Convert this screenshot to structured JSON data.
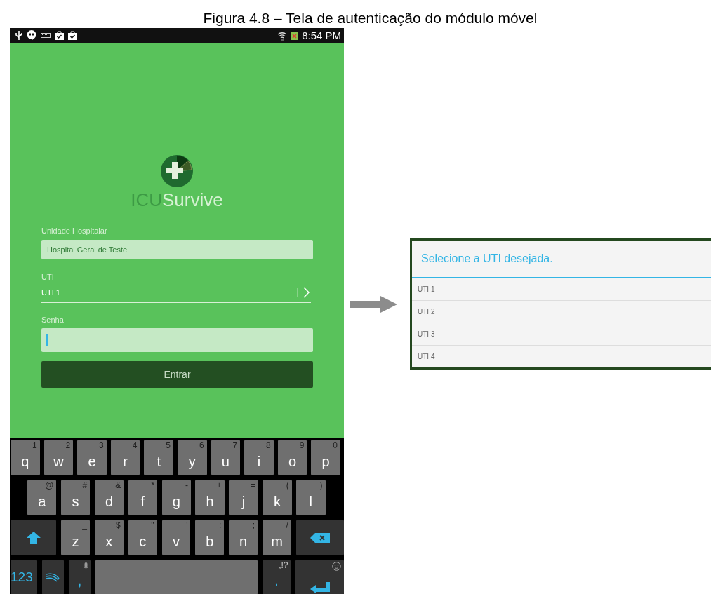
{
  "caption": "Figura 4.8 – Tela de autenticação do módulo móvel",
  "status_bar": {
    "time": "8:54 PM"
  },
  "app_name": {
    "prefix": "ICU",
    "suffix": "Survive"
  },
  "form": {
    "hospital": {
      "label": "Unidade Hospitalar",
      "value": "Hospital Geral de Teste"
    },
    "uti": {
      "label": "UTI",
      "value": "UTI 1"
    },
    "password": {
      "label": "Senha",
      "focused": true
    },
    "submit": "Entrar"
  },
  "keyboard": {
    "letter_row_1": [
      {
        "kind": "char",
        "label": "q",
        "hint": "1"
      },
      {
        "kind": "char",
        "label": "w",
        "hint": "2"
      },
      {
        "kind": "char",
        "label": "e",
        "hint": "3"
      },
      {
        "kind": "char",
        "label": "r",
        "hint": "4"
      },
      {
        "kind": "char",
        "label": "t",
        "hint": "5"
      },
      {
        "kind": "char",
        "label": "y",
        "hint": "6"
      },
      {
        "kind": "char",
        "label": "u",
        "hint": "7"
      },
      {
        "kind": "char",
        "label": "i",
        "hint": "8"
      },
      {
        "kind": "char",
        "label": "o",
        "hint": "9"
      },
      {
        "kind": "char",
        "label": "p",
        "hint": "0"
      }
    ],
    "letter_row_2": [
      {
        "kind": "char",
        "label": "a",
        "hint": "@"
      },
      {
        "kind": "char",
        "label": "s",
        "hint": "#"
      },
      {
        "kind": "char",
        "label": "d",
        "hint": "&"
      },
      {
        "kind": "char",
        "label": "f",
        "hint": "*"
      },
      {
        "kind": "char",
        "label": "g",
        "hint": "-"
      },
      {
        "kind": "char",
        "label": "h",
        "hint": "+"
      },
      {
        "kind": "char",
        "label": "j",
        "hint": "="
      },
      {
        "kind": "char",
        "label": "k",
        "hint": "("
      },
      {
        "kind": "char",
        "label": "l",
        "hint": ")"
      }
    ],
    "letter_row_3": [
      {
        "kind": "shift"
      },
      {
        "kind": "char",
        "label": "z",
        "hint": "_"
      },
      {
        "kind": "char",
        "label": "x",
        "hint": "$"
      },
      {
        "kind": "char",
        "label": "c",
        "hint": "\""
      },
      {
        "kind": "char",
        "label": "v",
        "hint": "'"
      },
      {
        "kind": "char",
        "label": "b",
        "hint": ":"
      },
      {
        "kind": "char",
        "label": "n",
        "hint": ";"
      },
      {
        "kind": "char",
        "label": "m",
        "hint": "/"
      },
      {
        "kind": "backspace"
      }
    ],
    "function_row": [
      {
        "kind": "mode",
        "label": "123"
      },
      {
        "kind": "swype"
      },
      {
        "kind": "voice",
        "label": ","
      },
      {
        "kind": "space"
      },
      {
        "kind": "punct",
        "label": ".",
        "hint": ",!?"
      },
      {
        "kind": "enter"
      }
    ]
  },
  "dialog": {
    "title": "Selecione a UTI desejada.",
    "items": [
      {
        "label": "UTI 1",
        "selected": false
      },
      {
        "label": "UTI 2",
        "selected": false
      },
      {
        "label": "UTI 3",
        "selected": false
      },
      {
        "label": "UTI 4",
        "selected": false
      }
    ]
  }
}
